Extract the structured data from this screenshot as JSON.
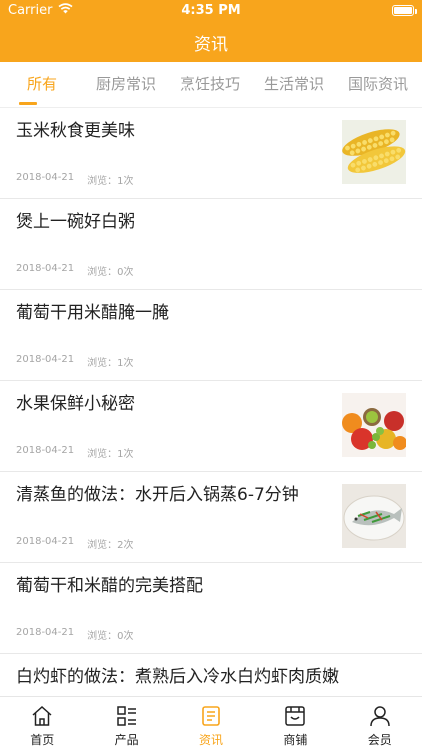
{
  "status": {
    "carrier": "Carrier",
    "time": "4:35 PM"
  },
  "nav": {
    "title": "资讯"
  },
  "tabs": [
    {
      "label": "所有"
    },
    {
      "label": "厨房常识"
    },
    {
      "label": "烹饪技巧"
    },
    {
      "label": "生活常识"
    },
    {
      "label": "国际资讯"
    }
  ],
  "articles": [
    {
      "title": "玉米秋食更美味",
      "date": "2018-04-21",
      "views": "浏览：1次",
      "thumb": "corn"
    },
    {
      "title": "煲上一碗好白粥",
      "date": "2018-04-21",
      "views": "浏览：0次"
    },
    {
      "title": "葡萄干用米醋腌一腌",
      "date": "2018-04-21",
      "views": "浏览：1次"
    },
    {
      "title": "水果保鲜小秘密",
      "date": "2018-04-21",
      "views": "浏览：1次",
      "thumb": "fruits"
    },
    {
      "title": "清蒸鱼的做法：水开后入锅蒸6-7分钟",
      "date": "2018-04-21",
      "views": "浏览：2次",
      "thumb": "steamed-fish"
    },
    {
      "title": "葡萄干和米醋的完美搭配",
      "date": "2018-04-21",
      "views": "浏览：0次"
    },
    {
      "title": "白灼虾的做法：煮熟后入冷水白灼虾肉质嫩"
    }
  ],
  "tabbar": [
    {
      "label": "首页",
      "icon": "home-icon"
    },
    {
      "label": "产品",
      "icon": "list-icon"
    },
    {
      "label": "资讯",
      "icon": "news-icon"
    },
    {
      "label": "商铺",
      "icon": "shop-icon"
    },
    {
      "label": "会员",
      "icon": "user-icon"
    }
  ],
  "colors": {
    "accent": "#f8a51c",
    "text": "#222222",
    "meta": "#a5a5a5"
  }
}
